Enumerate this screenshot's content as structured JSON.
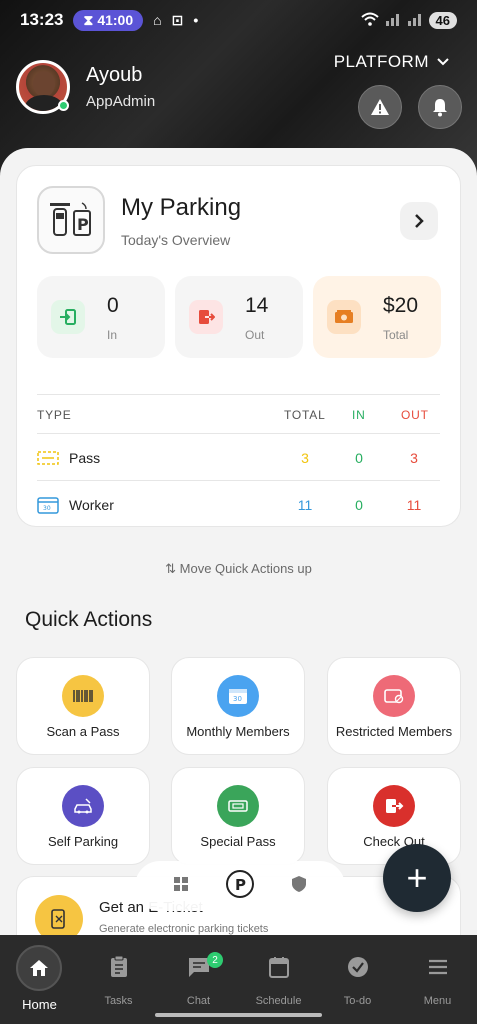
{
  "status_bar": {
    "time": "13:23",
    "timer": "41:00",
    "battery": "46"
  },
  "header": {
    "user_name": "Ayoub",
    "user_role": "AppAdmin",
    "platform_label": "PLATFORM"
  },
  "parking_card": {
    "title": "My Parking",
    "subtitle": "Today's Overview",
    "stats": [
      {
        "value": "0",
        "label": "In",
        "color": "#27ae60",
        "bg": "#e3f6e8"
      },
      {
        "value": "14",
        "label": "Out",
        "color": "#e74c3c",
        "bg": "#fde4e4"
      },
      {
        "value": "$20",
        "label": "Total",
        "color": "#e67e22",
        "bg": "#fde7cf"
      }
    ],
    "table": {
      "headers": {
        "type": "TYPE",
        "total": "TOTAL",
        "in": "IN",
        "out": "OUT"
      },
      "rows": [
        {
          "name": "Pass",
          "total": "3",
          "in": "0",
          "out": "3",
          "total_color": "#f1c40f"
        },
        {
          "name": "Worker",
          "total": "11",
          "in": "0",
          "out": "11",
          "total_color": "#3498db"
        }
      ]
    }
  },
  "move_hint": "Move Quick Actions up",
  "quick_actions": {
    "title": "Quick Actions",
    "items": [
      {
        "label": "Scan a Pass",
        "icon": "barcode-icon",
        "color": "#f6c542"
      },
      {
        "label": "Monthly Members",
        "icon": "calendar-icon",
        "color": "#4aa3f0"
      },
      {
        "label": "Restricted Members",
        "icon": "restricted-card-icon",
        "color": "#ee6a77"
      },
      {
        "label": "Self Parking",
        "icon": "self-parking-icon",
        "color": "#5b4fc4"
      },
      {
        "label": "Special Pass",
        "icon": "ticket-icon",
        "color": "#3aa55a"
      },
      {
        "label": "Check Out",
        "icon": "exit-icon",
        "color": "#d9302c"
      }
    ]
  },
  "eticket": {
    "title": "Get an E-Ticket",
    "subtitle": "Generate electronic parking tickets"
  },
  "bottom_nav": {
    "items": [
      {
        "label": "Home"
      },
      {
        "label": "Tasks"
      },
      {
        "label": "Chat",
        "badge": "2"
      },
      {
        "label": "Schedule"
      },
      {
        "label": "To-do"
      },
      {
        "label": "Menu"
      }
    ]
  }
}
